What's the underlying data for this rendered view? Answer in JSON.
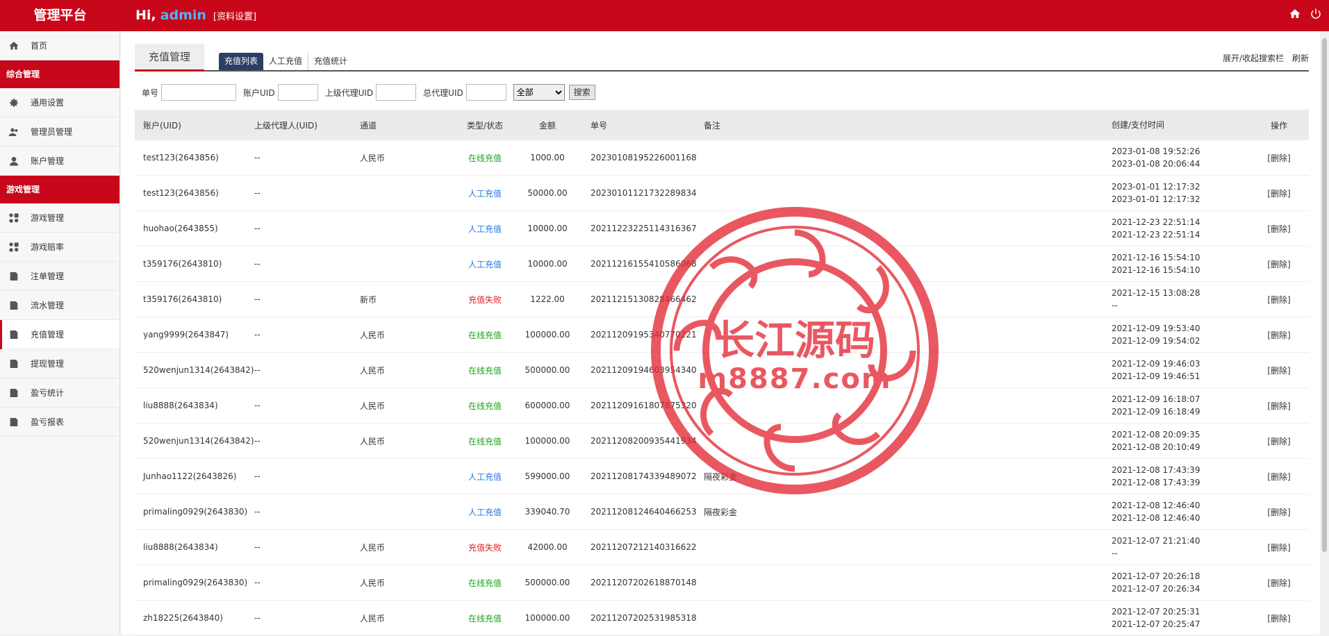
{
  "header": {
    "brand": "管理平台",
    "greeting": "Hi,",
    "username": "admin",
    "profile_link": "[资料设置]",
    "icons": [
      "home-icon",
      "power-icon"
    ]
  },
  "sidebar": {
    "home": "首页",
    "group1": "综合管理",
    "general_settings": "通用设置",
    "admin_management": "管理员管理",
    "account_management": "账户管理",
    "group2": "游戏管理",
    "game_management": "游戏管理",
    "game_odds": "游戏赔率",
    "bet_management": "注单管理",
    "flow_management": "流水管理",
    "recharge_management": "充值管理",
    "withdraw_management": "提现管理",
    "profit_stats": "盈亏统计",
    "profit_report": "盈亏报表"
  },
  "tabs": {
    "main": "充值管理",
    "sub": [
      "充值列表",
      "人工充值",
      "充值统计"
    ],
    "toggle_search": "展开/收起搜索栏",
    "refresh": "刷新"
  },
  "search": {
    "order_label": "单号",
    "account_uid_label": "账户UID",
    "parent_uid_label": "上级代理UID",
    "top_uid_label": "总代理UID",
    "select_value": "全部",
    "button": "搜索"
  },
  "table": {
    "headers": [
      "账户(UID)",
      "上级代理人(UID)",
      "通道",
      "类型/状态",
      "金额",
      "单号",
      "备注",
      "创建/支付时间",
      "操作"
    ],
    "rows": [
      {
        "account": "test123(2643856)",
        "parent": "--",
        "channel": "人民币",
        "status": "在线充值",
        "status_color": "green",
        "amount": "1000.00",
        "order": "20230108195226001168",
        "note": "",
        "created": "2023-01-08 19:52:26",
        "paid": "2023-01-08 20:06:44",
        "action": "[删除]"
      },
      {
        "account": "test123(2643856)",
        "parent": "--",
        "channel": "",
        "status": "人工充值",
        "status_color": "blue",
        "amount": "50000.00",
        "order": "20230101121732289834",
        "note": "",
        "created": "2023-01-01 12:17:32",
        "paid": "2023-01-01 12:17:32",
        "action": "[删除]"
      },
      {
        "account": "huohao(2643855)",
        "parent": "--",
        "channel": "",
        "status": "人工充值",
        "status_color": "blue",
        "amount": "10000.00",
        "order": "20211223225114316367",
        "note": "",
        "created": "2021-12-23 22:51:14",
        "paid": "2021-12-23 22:51:14",
        "action": "[删除]"
      },
      {
        "account": "t359176(2643810)",
        "parent": "--",
        "channel": "",
        "status": "人工充值",
        "status_color": "blue",
        "amount": "10000.00",
        "order": "20211216155410586068",
        "note": "",
        "created": "2021-12-16 15:54:10",
        "paid": "2021-12-16 15:54:10",
        "action": "[删除]"
      },
      {
        "account": "t359176(2643810)",
        "parent": "--",
        "channel": "新币",
        "status": "充值失败",
        "status_color": "red",
        "amount": "1222.00",
        "order": "20211215130828466462",
        "note": "",
        "created": "2021-12-15 13:08:28",
        "paid": "--",
        "action": "[删除]"
      },
      {
        "account": "yang9999(2643847)",
        "parent": "--",
        "channel": "人民币",
        "status": "在线充值",
        "status_color": "green",
        "amount": "100000.00",
        "order": "20211209195340770221",
        "note": "",
        "created": "2021-12-09 19:53:40",
        "paid": "2021-12-09 19:54:02",
        "action": "[删除]"
      },
      {
        "account": "520wenjun1314(2643842)",
        "parent": "--",
        "channel": "人民币",
        "status": "在线充值",
        "status_color": "green",
        "amount": "500000.00",
        "order": "20211209194603954340",
        "note": "",
        "created": "2021-12-09 19:46:03",
        "paid": "2021-12-09 19:46:51",
        "action": "[删除]"
      },
      {
        "account": "liu8888(2643834)",
        "parent": "--",
        "channel": "人民币",
        "status": "在线充值",
        "status_color": "green",
        "amount": "600000.00",
        "order": "20211209161807875320",
        "note": "",
        "created": "2021-12-09 16:18:07",
        "paid": "2021-12-09 16:18:49",
        "action": "[删除]"
      },
      {
        "account": "520wenjun1314(2643842)",
        "parent": "--",
        "channel": "人民币",
        "status": "在线充值",
        "status_color": "green",
        "amount": "100000.00",
        "order": "20211208200935441934",
        "note": "",
        "created": "2021-12-08 20:09:35",
        "paid": "2021-12-08 20:10:49",
        "action": "[删除]"
      },
      {
        "account": "Junhao1122(2643826)",
        "parent": "--",
        "channel": "",
        "status": "人工充值",
        "status_color": "blue",
        "amount": "599000.00",
        "order": "20211208174339489072",
        "note": "隔夜彩金",
        "created": "2021-12-08 17:43:39",
        "paid": "2021-12-08 17:43:39",
        "action": "[删除]"
      },
      {
        "account": "primaling0929(2643830)",
        "parent": "--",
        "channel": "",
        "status": "人工充值",
        "status_color": "blue",
        "amount": "339040.70",
        "order": "20211208124640466253",
        "note": "隔夜彩金",
        "created": "2021-12-08 12:46:40",
        "paid": "2021-12-08 12:46:40",
        "action": "[删除]"
      },
      {
        "account": "liu8888(2643834)",
        "parent": "--",
        "channel": "人民币",
        "status": "充值失败",
        "status_color": "red",
        "amount": "42000.00",
        "order": "20211207212140316622",
        "note": "",
        "created": "2021-12-07 21:21:40",
        "paid": "--",
        "action": "[删除]"
      },
      {
        "account": "primaling0929(2643830)",
        "parent": "--",
        "channel": "人民币",
        "status": "在线充值",
        "status_color": "green",
        "amount": "500000.00",
        "order": "20211207202618870148",
        "note": "",
        "created": "2021-12-07 20:26:18",
        "paid": "2021-12-07 20:26:34",
        "action": "[删除]"
      },
      {
        "account": "zh18225(2643840)",
        "parent": "--",
        "channel": "人民币",
        "status": "在线充值",
        "status_color": "green",
        "amount": "100000.00",
        "order": "20211207202531985318",
        "note": "",
        "created": "2021-12-07 20:25:31",
        "paid": "2021-12-07 20:25:47",
        "action": "[删除]"
      }
    ]
  },
  "watermark": {
    "title": "长江源码",
    "url": "m8887.com",
    "color": "#e32a35"
  }
}
